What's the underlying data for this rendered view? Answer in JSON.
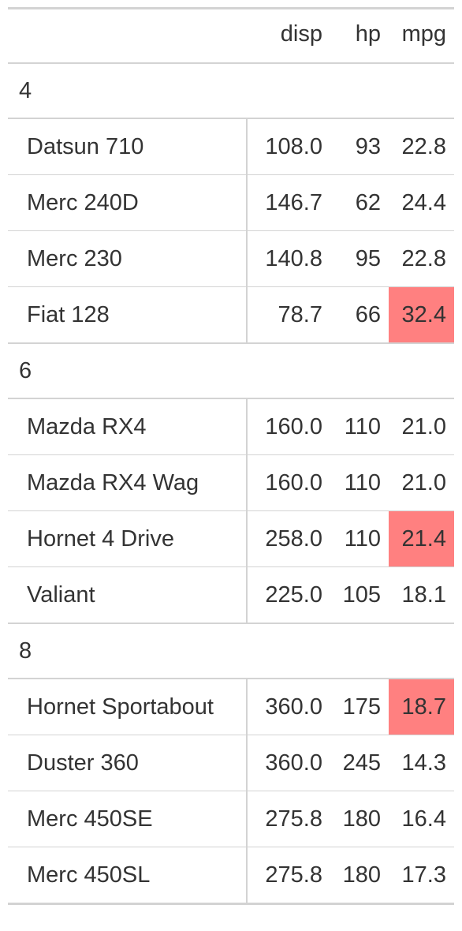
{
  "columns": {
    "stub": "",
    "disp": "disp",
    "hp": "hp",
    "mpg": "mpg"
  },
  "highlight_color": "#ff8080",
  "groups": [
    {
      "label": "4",
      "rows": [
        {
          "name": "Datsun 710",
          "disp": "108.0",
          "hp": "93",
          "mpg": "22.8",
          "mpg_highlight": false
        },
        {
          "name": "Merc 240D",
          "disp": "146.7",
          "hp": "62",
          "mpg": "24.4",
          "mpg_highlight": false
        },
        {
          "name": "Merc 230",
          "disp": "140.8",
          "hp": "95",
          "mpg": "22.8",
          "mpg_highlight": false
        },
        {
          "name": "Fiat 128",
          "disp": "78.7",
          "hp": "66",
          "mpg": "32.4",
          "mpg_highlight": true
        }
      ]
    },
    {
      "label": "6",
      "rows": [
        {
          "name": "Mazda RX4",
          "disp": "160.0",
          "hp": "110",
          "mpg": "21.0",
          "mpg_highlight": false
        },
        {
          "name": "Mazda RX4 Wag",
          "disp": "160.0",
          "hp": "110",
          "mpg": "21.0",
          "mpg_highlight": false
        },
        {
          "name": "Hornet 4 Drive",
          "disp": "258.0",
          "hp": "110",
          "mpg": "21.4",
          "mpg_highlight": true
        },
        {
          "name": "Valiant",
          "disp": "225.0",
          "hp": "105",
          "mpg": "18.1",
          "mpg_highlight": false
        }
      ]
    },
    {
      "label": "8",
      "rows": [
        {
          "name": "Hornet Sportabout",
          "disp": "360.0",
          "hp": "175",
          "mpg": "18.7",
          "mpg_highlight": true
        },
        {
          "name": "Duster 360",
          "disp": "360.0",
          "hp": "245",
          "mpg": "14.3",
          "mpg_highlight": false
        },
        {
          "name": "Merc 450SE",
          "disp": "275.8",
          "hp": "180",
          "mpg": "16.4",
          "mpg_highlight": false
        },
        {
          "name": "Merc 450SL",
          "disp": "275.8",
          "hp": "180",
          "mpg": "17.3",
          "mpg_highlight": false
        }
      ]
    }
  ]
}
